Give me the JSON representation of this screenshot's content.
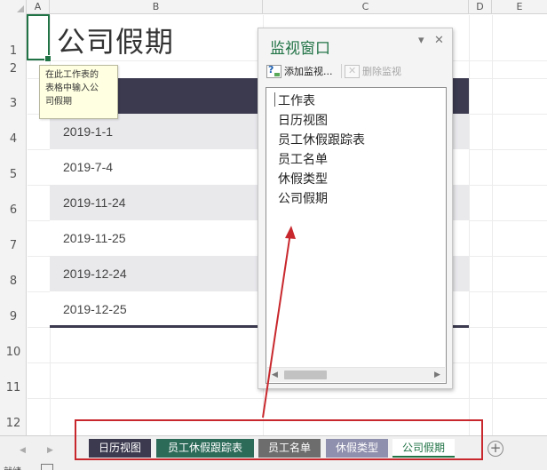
{
  "columns": [
    "A",
    "B",
    "C",
    "D",
    "E"
  ],
  "rows": [
    "1",
    "2",
    "3",
    "4",
    "5",
    "6",
    "7",
    "8",
    "9",
    "10",
    "11",
    "12"
  ],
  "sheet": {
    "title": "公司假期",
    "dates": [
      "2019-1-1",
      "2019-7-4",
      "2019-11-24",
      "2019-11-25",
      "2019-12-24",
      "2019-12-25"
    ]
  },
  "tooltip": {
    "lines": [
      "在此工作表的",
      "表格中输入公",
      "司假期"
    ]
  },
  "watch_window": {
    "title": "监视窗口",
    "add_label": "添加监视...",
    "delete_label": "删除监视",
    "items": [
      "工作表",
      "日历视图",
      "员工休假跟踪表",
      "员工名单",
      "休假类型",
      "公司假期"
    ]
  },
  "tabs": [
    {
      "label": "日历视图",
      "color": "#3b3a4f"
    },
    {
      "label": "员工休假跟踪表",
      "color": "#2d6b59"
    },
    {
      "label": "员工名单",
      "color": "#6d6d6d"
    },
    {
      "label": "休假类型",
      "color": "#8f8fae"
    },
    {
      "label": "公司假期",
      "color": "#ffffff"
    }
  ],
  "status": {
    "mode": "就绪"
  },
  "colors": {
    "accent": "#217346",
    "table_header": "#3b3a4f",
    "annotation": "#c8282d"
  }
}
